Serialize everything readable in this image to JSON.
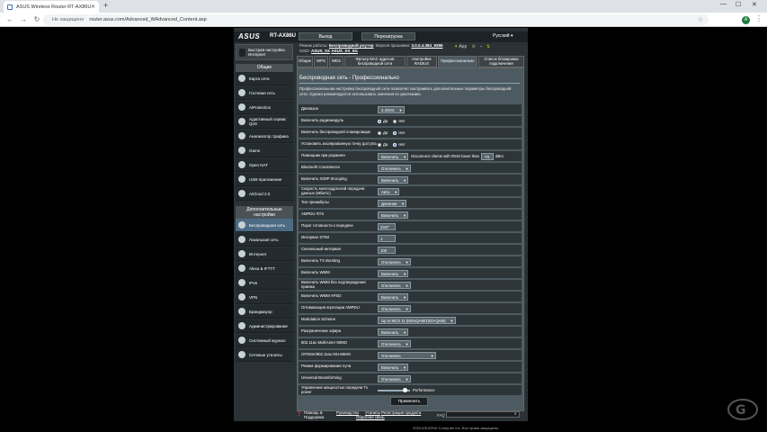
{
  "browser": {
    "tab_title": "ASUS Wireless Router RT-AX86U",
    "not_secure": "Не защищено",
    "url": "router.asus.com/Advanced_WAdvanced_Content.asp",
    "new_tab": "+",
    "avatar_letter": "A"
  },
  "header": {
    "logo": "ASUS",
    "model": "RT-AX86U",
    "logout": "Выход",
    "reboot": "Перезагрузка",
    "language": "Русский ▾"
  },
  "status": {
    "mode_label": "Режим работы:",
    "mode_value": "Беспроводной роутер",
    "fw_label": "Версия прошивки:",
    "fw_value": "3.0.0.4.384_9296",
    "ssid_label": "SSID:",
    "ssid1": "ASUS_XX",
    "ssid2": "ASUS_XX_5G",
    "app": "App"
  },
  "sidebar": {
    "quick": "Быстрая настройка Интернет",
    "general": "Общие",
    "general_items": [
      "Карта сети",
      "Гостевая сеть",
      "AiProtection",
      "Адаптивный сервис QoS",
      "Анализатор трафика",
      "Game",
      "Open NAT",
      "USB-приложение",
      "AiCloud 2.0"
    ],
    "advanced": "Дополнительные настройки",
    "advanced_items": [
      "Беспроводная сеть",
      "Локальная сеть",
      "Интернет",
      "Alexa & IFTTT",
      "IPv6",
      "VPN",
      "Брандмауэр",
      "Администрирование",
      "Системный журнал",
      "Сетевые утилиты"
    ]
  },
  "tabs": [
    "Общие",
    "WPS",
    "WDS",
    "Фильтр MAC адресов беспроводной сети",
    "Настройка RADIUS",
    "Профессионально",
    "Список блокировки подключения"
  ],
  "main": {
    "title": "Беспроводная сеть - Профессионально",
    "desc": "Профессиональная настройка беспроводной сети позволяет настраивать дополнительные параметры беспроводной сети. Однако рекомендуется использовать значения по умолчанию.",
    "yes": "Да",
    "no": "Нет",
    "rows": {
      "band": {
        "label": "Диапазон",
        "value": "2.4GHz"
      },
      "radio": {
        "label": "Включить радиомодуль"
      },
      "schedule": {
        "label": "Включить беспроводной планировщик"
      },
      "isolate": {
        "label": "Установить изолированную точку доступа"
      },
      "roaming": {
        "label": "Помощник при роуминге",
        "value": "Включить",
        "text": "Disconnect clients with RSSI lower than",
        "rssi": "-70",
        "unit": "dBm"
      },
      "bt": {
        "label": "Bluetooth Coexistence",
        "value": "Отключить"
      },
      "igmp": {
        "label": "Включить IGMP Snooping",
        "value": "Включить"
      },
      "mrate": {
        "label": "Скорость многоадресной передачи данных (Мбит/с)",
        "value": "Авто"
      },
      "preamble": {
        "label": "Тип преамбулы",
        "value": "Длинная"
      },
      "ampdu_rts": {
        "label": "AMPDU RTS",
        "value": "Включить"
      },
      "rts": {
        "label": "Порог готовности к передаче",
        "value": "2347"
      },
      "dtim": {
        "label": "Интервал DTIM",
        "value": "1"
      },
      "beacon": {
        "label": "Сигнальный интервал",
        "value": "100"
      },
      "txburst": {
        "label": "Включить TX Bursting",
        "value": "Отключить"
      },
      "wmm": {
        "label": "Включить WMM",
        "value": "Включить"
      },
      "wmm_noack": {
        "label": "Включить WMM без подтверждения приема",
        "value": "Отключить"
      },
      "wmm_apsd": {
        "label": "Включить WMM APSD",
        "value": "Включить"
      },
      "ampdu_opt": {
        "label": "Оптимизация агрегации AMPDU",
        "value": "Отключить"
      },
      "modulation": {
        "label": "Modulation Scheme",
        "value": "Up to MCS 11 (NitroQAM/1024-QAM)"
      },
      "airtime": {
        "label": "Разграничение эфира",
        "value": "Включить"
      },
      "mumimo": {
        "label": "802.11ac Multi-User MIMO",
        "value": "Отключить"
      },
      "ofdma": {
        "label": "OFDMA/802.11ax MU-MIMO",
        "value": "Отключить"
      },
      "beamforming": {
        "label": "Режим формирования луча",
        "value": "Включить"
      },
      "ubeam": {
        "label": "Universal Beamforming",
        "value": "Отключить"
      },
      "txpower": {
        "label": "Управление мощностью передачи Tx power",
        "value": "Performance"
      }
    },
    "apply": "Применить"
  },
  "footer": {
    "help": "Помощь & Поддержка",
    "manual": "Руководство",
    "utility": "Утилиты",
    "register": "Регистрация продукта",
    "feedback": "Обратная связь",
    "faq": "FAQ",
    "copyright": "2020 ASUSTeK Computer Inc. Все права защищены."
  },
  "progress": {
    "tx_power_fraction": 0.9
  }
}
